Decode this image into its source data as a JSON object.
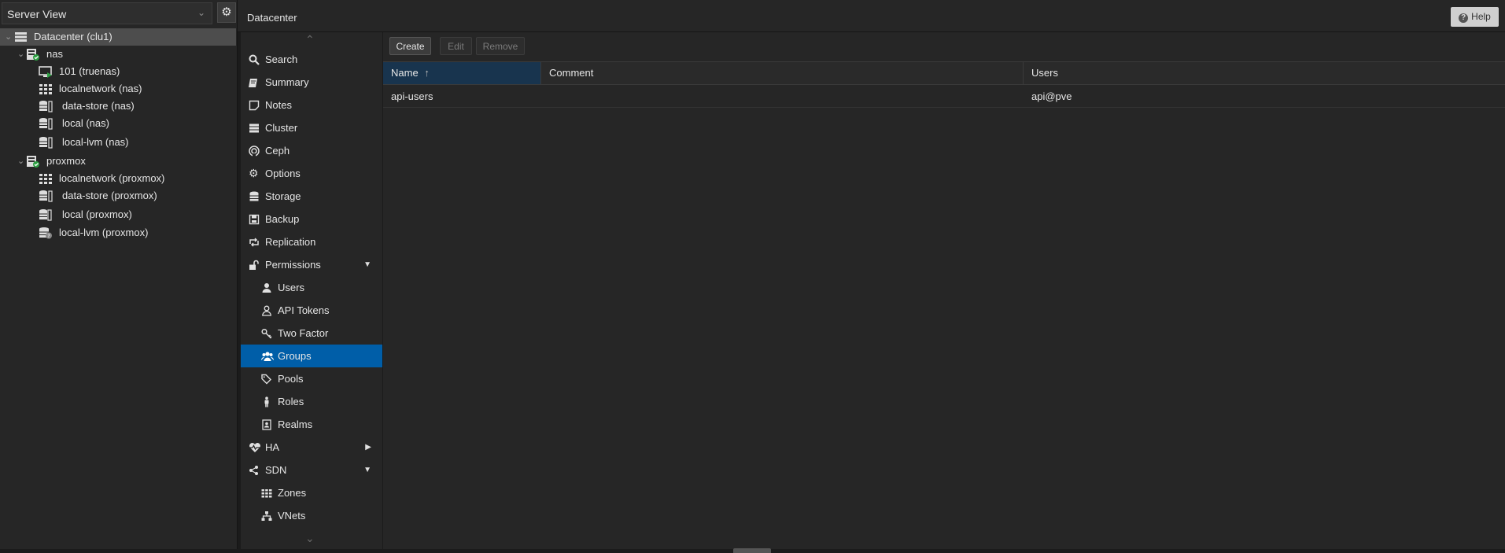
{
  "left_panel": {
    "view_selector": "Server View",
    "tree": [
      {
        "label": "Datacenter (clu1)",
        "icon": "datacenter-icon",
        "selected": true
      },
      {
        "label": "nas",
        "icon": "node-online-icon"
      },
      {
        "label": "101 (truenas)",
        "icon": "vm-running-icon"
      },
      {
        "label": "localnetwork (nas)",
        "icon": "network-grid-icon"
      },
      {
        "label": "data-store (nas)",
        "icon": "storage-icon"
      },
      {
        "label": "local (nas)",
        "icon": "storage-icon"
      },
      {
        "label": "local-lvm (nas)",
        "icon": "storage-icon"
      },
      {
        "label": "proxmox",
        "icon": "node-online-icon"
      },
      {
        "label": "localnetwork (proxmox)",
        "icon": "network-grid-icon"
      },
      {
        "label": "data-store (proxmox)",
        "icon": "storage-icon"
      },
      {
        "label": "local (proxmox)",
        "icon": "storage-icon"
      },
      {
        "label": "local-lvm (proxmox)",
        "icon": "storage-unknown-icon"
      }
    ]
  },
  "header": {
    "title": "Datacenter",
    "help_label": "Help"
  },
  "nav": {
    "items": [
      {
        "label": "Search",
        "icon": "search-icon"
      },
      {
        "label": "Summary",
        "icon": "book-icon"
      },
      {
        "label": "Notes",
        "icon": "note-icon"
      },
      {
        "label": "Cluster",
        "icon": "server-icon"
      },
      {
        "label": "Ceph",
        "icon": "ceph-icon"
      },
      {
        "label": "Options",
        "icon": "gear-icon"
      },
      {
        "label": "Storage",
        "icon": "database-icon"
      },
      {
        "label": "Backup",
        "icon": "floppy-icon"
      },
      {
        "label": "Replication",
        "icon": "retweet-icon"
      },
      {
        "label": "Permissions",
        "icon": "unlock-icon"
      },
      {
        "label": "Users",
        "icon": "user-icon"
      },
      {
        "label": "API Tokens",
        "icon": "user-outline-icon"
      },
      {
        "label": "Two Factor",
        "icon": "key-icon"
      },
      {
        "label": "Groups",
        "icon": "users-icon"
      },
      {
        "label": "Pools",
        "icon": "tags-icon"
      },
      {
        "label": "Roles",
        "icon": "male-icon"
      },
      {
        "label": "Realms",
        "icon": "address-book-icon"
      },
      {
        "label": "HA",
        "icon": "heartbeat-icon"
      },
      {
        "label": "SDN",
        "icon": "sdn-icon"
      },
      {
        "label": "Zones",
        "icon": "grid-icon"
      },
      {
        "label": "VNets",
        "icon": "sitemap-icon"
      }
    ]
  },
  "toolbar": {
    "create": "Create",
    "edit": "Edit",
    "remove": "Remove"
  },
  "grid": {
    "columns": [
      "Name",
      "Comment",
      "Users"
    ],
    "sorted_column": "Name",
    "sort_direction": "ascending",
    "rows": [
      {
        "name": "api-users",
        "comment": "",
        "users": "api@pve"
      }
    ]
  },
  "colors": {
    "selected_nav": "#005ea8",
    "background": "#262626",
    "sorted_header": "#18344e"
  }
}
